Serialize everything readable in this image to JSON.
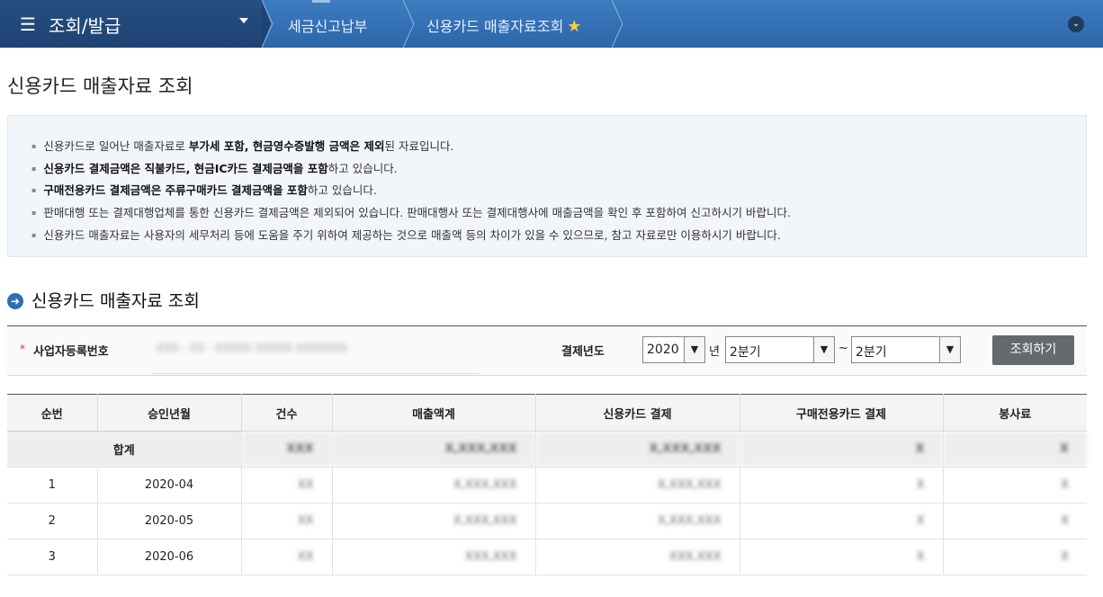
{
  "topbar": {
    "menu_icon": "☰",
    "main_crumb": "조회/발급",
    "crumb1": "세금신고납부",
    "crumb2": "신용카드 매출자료조회",
    "star_icon": "★",
    "collapse_icon": "⌄"
  },
  "page_title": "신용카드 매출자료 조회",
  "notice": {
    "line1_a": "신용카드로 일어난 매출자료로 ",
    "line1_b": "부가세 포함, 현금영수증발행 금액은 제외",
    "line1_c": "된 자료입니다.",
    "line2_a": "신용카드 결제금액은 직불카드, 현금IC카드 결제금액을 포함",
    "line2_b": "하고 있습니다.",
    "line3_a": "구매전용카드 결제금액은 주류구매카드 결제금액을 포함",
    "line3_b": "하고 있습니다.",
    "line4": "판매대행 또는 결제대행업체를 통한 신용카드 결제금액은 제외되어 있습니다. 판매대행사 또는 결제대행사에 매출금액을 확인 후 포함하여 신고하시기 바랍니다.",
    "line5": "신용카드 매출자료는 사용자의 세무처리 등에 도움을 주기 위하여 제공하는 것으로 매출액 등의 차이가 있을 수 있으므로, 참고 자료로만 이용하시기 바랍니다."
  },
  "section_title": "신용카드 매출자료 조회",
  "search": {
    "required_mark": "*",
    "biz_label": "사업자등록번호",
    "biz_value": "XXX - XX - XXXXX  XXXXX XXXXXXX",
    "year_label": "결제년도",
    "year": "2020",
    "year_unit": "년",
    "from_quarter": "2분기",
    "tilde": "~",
    "to_quarter": "2분기",
    "button": "조회하기"
  },
  "table": {
    "headers": [
      "순번",
      "승인년월",
      "건수",
      "매출액계",
      "신용카드 결제",
      "구매전용카드 결제",
      "봉사료"
    ],
    "total_label": "합계",
    "total": [
      "XXX",
      "X,XXX,XXX",
      "X,XXX,XXX",
      "X",
      "X"
    ],
    "rows": [
      {
        "no": "1",
        "ym": "2020-04",
        "vals": [
          "XX",
          "X,XXX,XXX",
          "X,XXX,XXX",
          "X",
          "X"
        ]
      },
      {
        "no": "2",
        "ym": "2020-05",
        "vals": [
          "XX",
          "X,XXX,XXX",
          "X,XXX,XXX",
          "X",
          "X"
        ]
      },
      {
        "no": "3",
        "ym": "2020-06",
        "vals": [
          "XX",
          "XXX,XXX",
          "XXX,XXX",
          "X",
          "X"
        ]
      }
    ]
  }
}
